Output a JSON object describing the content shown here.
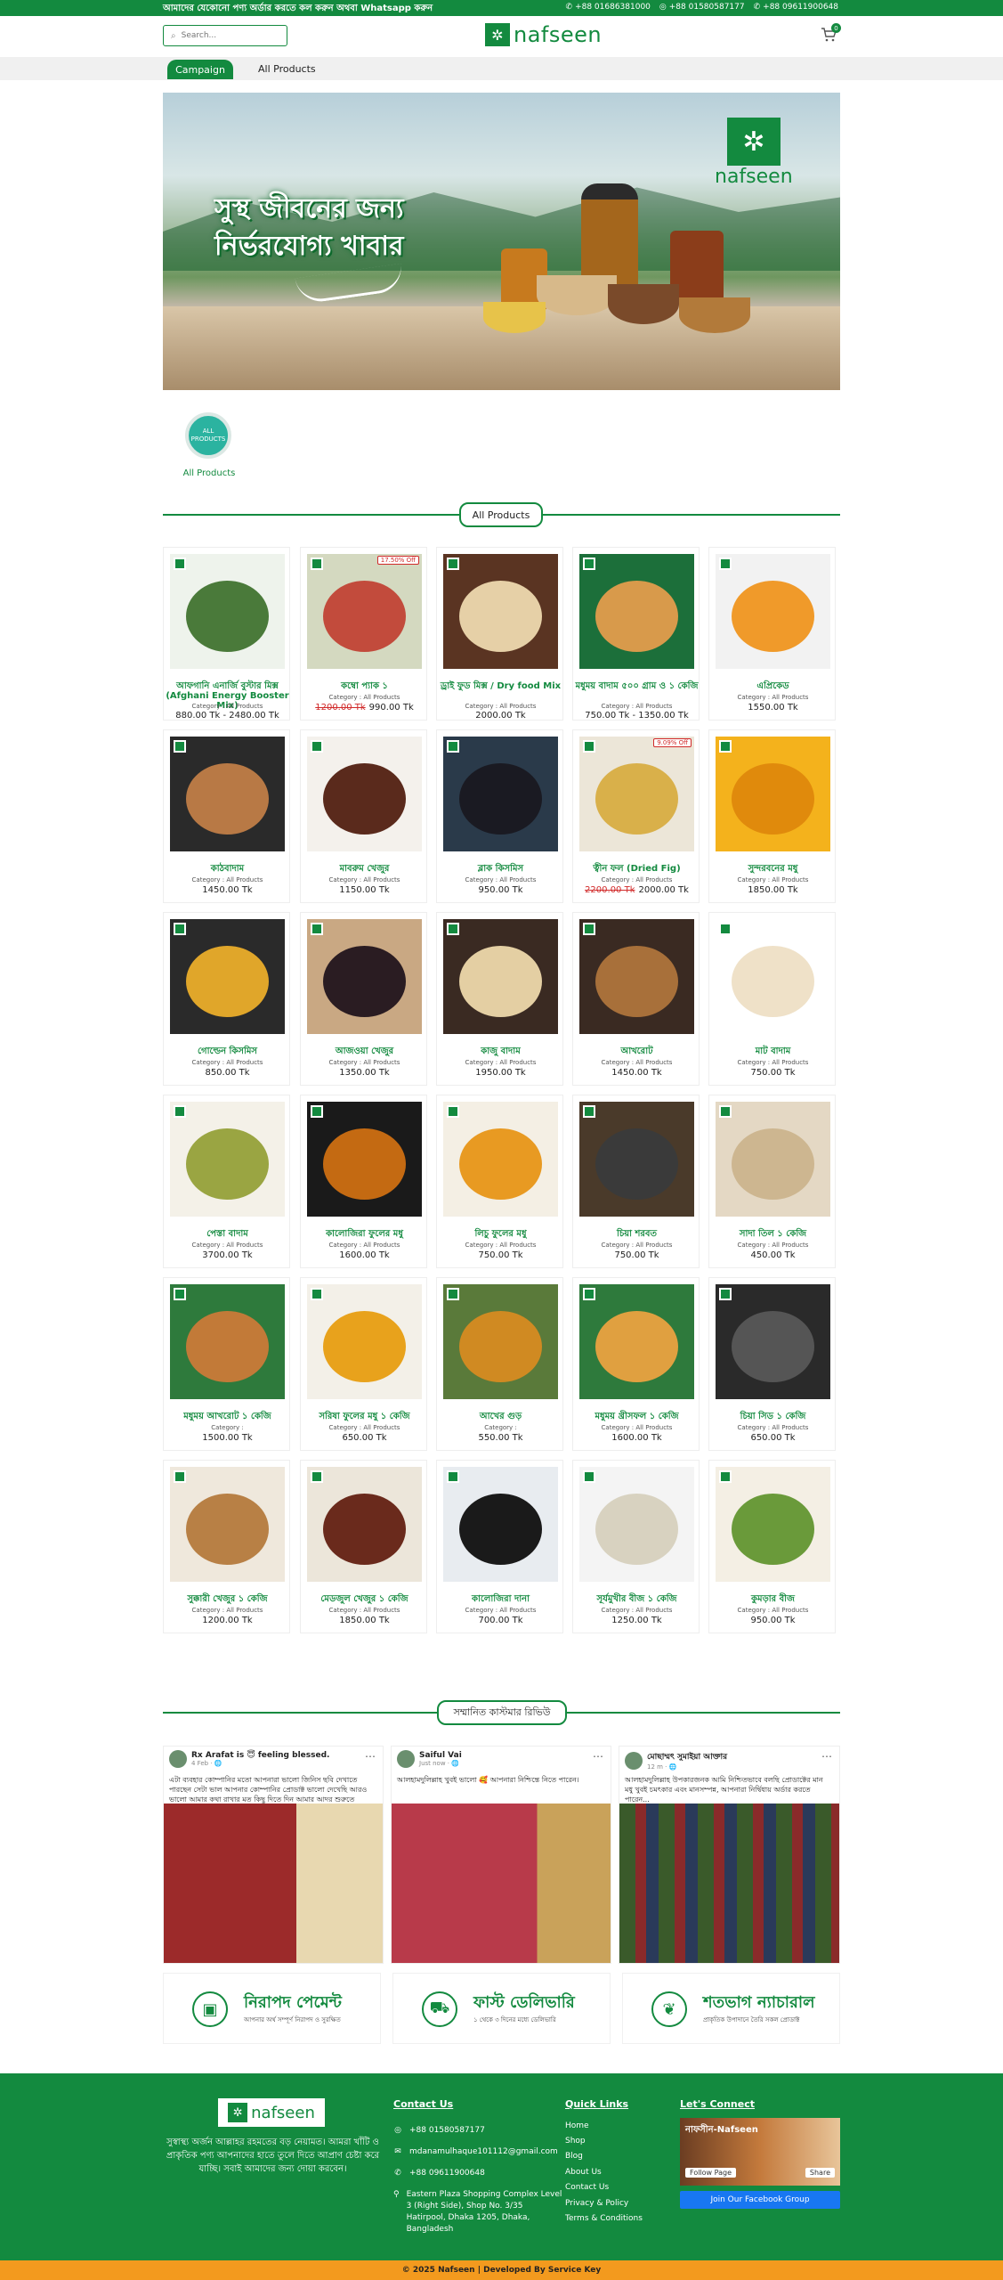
{
  "topbar": {
    "notice": "আমাদের যেকোনো পণ্য অর্ডার করতে কল করুন অথবা Whatsapp করুন",
    "phone1": "+88 01686381000",
    "whatsapp": "+88 01580587177",
    "phone2": "+88 09611900648"
  },
  "header": {
    "search_placeholder": "Search...",
    "logo_text": "nafseen",
    "cart_count": "0"
  },
  "nav": {
    "campaign": "Campaign",
    "all_products": "All Products"
  },
  "banner": {
    "headline_line1": "সুস্থ জীবনের জন্য",
    "headline_line2": "নির্ভরযোগ্য খাবার",
    "logo_text": "nafseen"
  },
  "category": {
    "circle_text": "ALL PRODUCTS",
    "label": "All Products"
  },
  "products_section_title": "All Products",
  "products": [
    {
      "title": "আফগানি এনার্জি বুস্টার মিক্স (Afghani Energy Booster Mix)",
      "category": "Category : All Products",
      "price": "880.00 Tk - 2480.00 Tk",
      "old_price": "",
      "discount": "",
      "colors": [
        "#eef3ec",
        "#4a7a3a"
      ]
    },
    {
      "title": "কম্বো প্যাক ১",
      "category": "Category : All Products",
      "price": "990.00 Tk",
      "old_price": "1200.00 Tk",
      "discount": "17.50% Off",
      "colors": [
        "#d4d9c0",
        "#c24b3c"
      ]
    },
    {
      "title": "ড্রাই ফুড মিক্স / Dry food Mix",
      "category": "Category : All Products",
      "price": "2000.00 Tk",
      "old_price": "",
      "discount": "",
      "colors": [
        "#5a3422",
        "#e6d0a7"
      ]
    },
    {
      "title": "মধুময় বাদাম ৫০০ গ্রাম ও ১ কেজি",
      "category": "Category : All Products",
      "price": "750.00 Tk - 1350.00 Tk",
      "old_price": "",
      "discount": "",
      "colors": [
        "#1c6f3a",
        "#d89a4b"
      ]
    },
    {
      "title": "এপ্রিকেড",
      "category": "Category : All Products",
      "price": "1550.00 Tk",
      "old_price": "",
      "discount": "",
      "colors": [
        "#f2f2f2",
        "#f09a2a"
      ]
    },
    {
      "title": "কাঠবাদাম",
      "category": "Category : All Products",
      "price": "1450.00 Tk",
      "old_price": "",
      "discount": "",
      "colors": [
        "#2a2a2a",
        "#b87945"
      ]
    },
    {
      "title": "মাবরুম খেজুর",
      "category": "Category : All Products",
      "price": "1150.00 Tk",
      "old_price": "",
      "discount": "",
      "colors": [
        "#f4f1ec",
        "#5a2a1c"
      ]
    },
    {
      "title": "ব্লাক কিসমিস",
      "category": "Category : All Products",
      "price": "950.00 Tk",
      "old_price": "",
      "discount": "",
      "colors": [
        "#2a3a4a",
        "#1a1a22"
      ]
    },
    {
      "title": "ত্বীন ফল (Dried Fig)",
      "category": "Category : All Products",
      "price": "2000.00 Tk",
      "old_price": "2200.00 Tk",
      "discount": "9.09% Off",
      "colors": [
        "#ece6d8",
        "#d9b04a"
      ]
    },
    {
      "title": "সুন্দরবনের মধু",
      "category": "Category : All Products",
      "price": "1850.00 Tk",
      "old_price": "",
      "discount": "",
      "colors": [
        "#f4b21c",
        "#e08a0c"
      ]
    },
    {
      "title": "গোল্ডেন কিসমিস",
      "category": "Category : All Products",
      "price": "850.00 Tk",
      "old_price": "",
      "discount": "",
      "colors": [
        "#2a2a2a",
        "#e0a62a"
      ]
    },
    {
      "title": "আজওয়া খেজুর",
      "category": "Category : All Products",
      "price": "1350.00 Tk",
      "old_price": "",
      "discount": "",
      "colors": [
        "#c9a883",
        "#2a1c22"
      ]
    },
    {
      "title": "কাজু বাদাম",
      "category": "Category : All Products",
      "price": "1950.00 Tk",
      "old_price": "",
      "discount": "",
      "colors": [
        "#3a2a22",
        "#e4cfa3"
      ]
    },
    {
      "title": "আখরোট",
      "category": "Category : All Products",
      "price": "1450.00 Tk",
      "old_price": "",
      "discount": "",
      "colors": [
        "#3a2a22",
        "#a8703a"
      ]
    },
    {
      "title": "মাট বাদাম",
      "category": "Category : All Products",
      "price": "750.00 Tk",
      "old_price": "",
      "discount": "",
      "colors": [
        "#ffffff",
        "#efe1c8"
      ]
    },
    {
      "title": "পেস্তা বাদাম",
      "category": "Category : All Products",
      "price": "3700.00 Tk",
      "old_price": "",
      "discount": "",
      "colors": [
        "#f4f1e8",
        "#9aa542"
      ]
    },
    {
      "title": "কালোজিরা ফুলের মধু",
      "category": "Category : All Products",
      "price": "1600.00 Tk",
      "old_price": "",
      "discount": "",
      "colors": [
        "#1a1a1a",
        "#c46a12"
      ]
    },
    {
      "title": "লিচু ফুলের মধু",
      "category": "Category : All Products",
      "price": "750.00 Tk",
      "old_price": "",
      "discount": "",
      "colors": [
        "#f4efe4",
        "#e89a22"
      ]
    },
    {
      "title": "চিয়া শরবত",
      "category": "Category : All Products",
      "price": "750.00 Tk",
      "old_price": "",
      "discount": "",
      "colors": [
        "#4a3a2a",
        "#3a3a3a"
      ]
    },
    {
      "title": "সাদা তিল ১ কেজি",
      "category": "Category : All Products",
      "price": "450.00 Tk",
      "old_price": "",
      "discount": "",
      "colors": [
        "#e4d8c4",
        "#cdb690"
      ]
    },
    {
      "title": "মধুময় আখরোট ১ কেজি",
      "category": "Category :",
      "price": "1500.00 Tk",
      "old_price": "",
      "discount": "",
      "colors": [
        "#2e7a3c",
        "#c27a38"
      ]
    },
    {
      "title": "সরিষা ফুলের মধু ১ কেজি",
      "category": "Category : All Products",
      "price": "650.00 Tk",
      "old_price": "",
      "discount": "",
      "colors": [
        "#f3f0e8",
        "#e8a21c"
      ]
    },
    {
      "title": "আখের গুড়",
      "category": "Category :",
      "price": "550.00 Tk",
      "old_price": "",
      "discount": "",
      "colors": [
        "#5a7a3a",
        "#d08a22"
      ]
    },
    {
      "title": "মধুময় খ্রীসফল ১ কেজি",
      "category": "Category : All Products",
      "price": "1600.00 Tk",
      "old_price": "",
      "discount": "",
      "colors": [
        "#2e7a3c",
        "#e0a040"
      ]
    },
    {
      "title": "চিয়া সিড ১ কেজি",
      "category": "Category : All Products",
      "price": "650.00 Tk",
      "old_price": "",
      "discount": "",
      "colors": [
        "#2a2a2a",
        "#555555"
      ]
    },
    {
      "title": "সুক্কারী খেজুর ১ কেজি",
      "category": "Category : All Products",
      "price": "1200.00 Tk",
      "old_price": "",
      "discount": "",
      "colors": [
        "#efe8dc",
        "#b88045"
      ]
    },
    {
      "title": "মেডজুল খেজুর ১ কেজি",
      "category": "Category : All Products",
      "price": "1850.00 Tk",
      "old_price": "",
      "discount": "",
      "colors": [
        "#ece6da",
        "#6a2a1c"
      ]
    },
    {
      "title": "কালোজিরা দানা",
      "category": "Category : All Products",
      "price": "700.00 Tk",
      "old_price": "",
      "discount": "",
      "colors": [
        "#e8ecf0",
        "#1a1a1a"
      ]
    },
    {
      "title": "সূর্যমুখীর বীজ ১ কেজি",
      "category": "Category : All Products",
      "price": "1250.00 Tk",
      "old_price": "",
      "discount": "",
      "colors": [
        "#f4f4f4",
        "#d8d2c0"
      ]
    },
    {
      "title": "কুমড়ার বীজ",
      "category": "Category : All Products",
      "price": "950.00 Tk",
      "old_price": "",
      "discount": "",
      "colors": [
        "#f4efe4",
        "#6a9a3a"
      ]
    }
  ],
  "reviews_title": "সম্মানিত কাস্টমার রিভিউ",
  "reviews": [
    {
      "name": "Rx Arafat is 😇 feeling blessed.",
      "time": "4 Feb · 🌐",
      "text": "এটা ব্যবহার কোম্পানির মতো আপনারা ভালো জিনিস ছবি দেখাতে পারছেন সেটা ভাল আপনার কোম্পানির প্রোডাক্ট ভালো দেখেছি আরও ভালো আমার কথা রাখার মত কিছু দিতে দিন আমার আদর শুরুতে আবার আপনাকে..."
    },
    {
      "name": "Saiful Vai",
      "time": "Just now · 🌐",
      "text": "আলহামদুলিল্লাহ খুবই ভালো 🥰 আপনারা নিশ্চিন্তে নিতে পারেন।"
    },
    {
      "name": "মোছাম্মৎ সুমাইয়া আক্তার",
      "time": "12 m · 🌐",
      "text": "আলহামদুলিল্লাহ উপকারজনক আমি নিশ্চিতভাবে বলছি প্রোডাক্টের মান মধু খুবই চমৎকার এবং মানসম্পন্ন, আপনারা নির্দ্বিধায় অর্ডার করতে পারেন..."
    }
  ],
  "features": [
    {
      "title": "নিরাপদ পেমেন্ট",
      "sub": "আপনার অর্থ সম্পূর্ণ নিরাপদ ও সুরক্ষিত"
    },
    {
      "title": "ফাস্ট ডেলিভারি",
      "sub": "১ থেকে ৩ দিনের মধ্যে ডেলিভারি"
    },
    {
      "title": "শতভাগ ন্যাচারাল",
      "sub": "প্রাকৃতিক উপাদানে তৈরি সকল প্রোডাক্ট"
    }
  ],
  "footer": {
    "logo_text": "nafseen",
    "description": "সুস্বাস্থ্য অর্জন আল্লাহর রহমতের বড় নেয়ামত। আমরা খাঁটি ও প্রাকৃতিক পণ্য আপনাদের হাতে তুলে দিতে আপ্রাণ চেষ্টা করে যাচ্ছি। সবাই আমাদের জন্য দোয়া করবেন।",
    "contact_title": "Contact Us",
    "whatsapp": "+88 01580587177",
    "email": "mdanamulhaque101112@gmail.com",
    "phone": "+88 09611900648",
    "address": "Eastern Plaza Shopping Complex Level 3 (Right Side), Shop No. 3/35 Hatirpool, Dhaka 1205, Dhaka, Bangladesh",
    "quick_title": "Quick Links",
    "links": [
      "Home",
      "Shop",
      "Blog",
      "About Us",
      "Contact Us",
      "Privacy & Policy",
      "Terms & Conditions"
    ],
    "connect_title": "Let's Connect",
    "fb_page_name": "নাফসীন-Nafseen",
    "fb_follow": "Follow Page",
    "fb_share": "Share",
    "fb_button": "Join Our Facebook Group"
  },
  "copyright": "© 2025 Nafseen | Developed By Service Key",
  "colors": {
    "brand": "#138a3f",
    "accent": "#f39a1e",
    "discount": "#d12a2a"
  }
}
